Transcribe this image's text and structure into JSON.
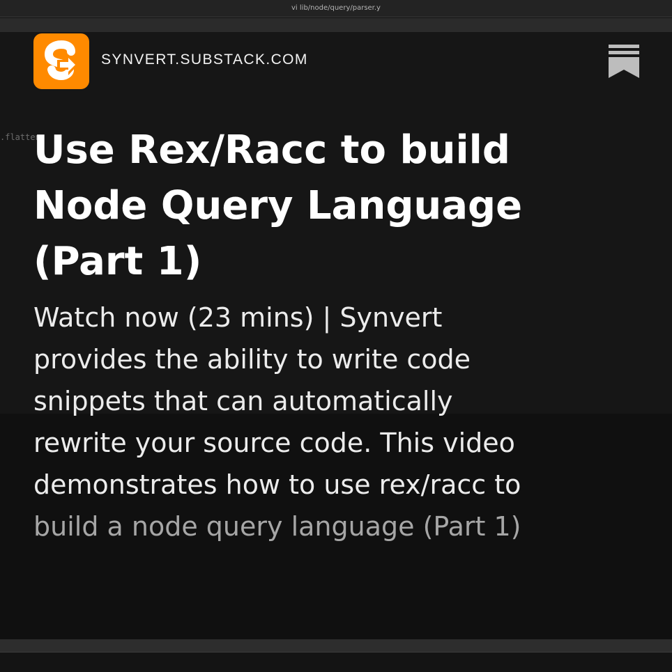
{
  "window": {
    "title": "vi lib/node/query/parser.y"
  },
  "background": {
    "code_fragment": ".flatten"
  },
  "header": {
    "logo_letter": "S",
    "domain": "SYNVERT.SUBSTACK.COM",
    "bookmark_icon": "bookmark-icon"
  },
  "article": {
    "title_lines": [
      "Use Rex/Racc to build",
      "Node Query Language",
      "(Part 1)"
    ],
    "description_lines": [
      "Watch now (23 mins) | Synvert",
      "provides the ability to write code",
      "snippets that can automatically",
      "rewrite your source code. This video",
      "demonstrates how to use rex/racc to",
      "build a node query language (Part 1)"
    ]
  },
  "colors": {
    "accent": "#ff8a00",
    "background": "#161616",
    "text": "#ffffff",
    "muted_text": "#a6a6a6"
  }
}
